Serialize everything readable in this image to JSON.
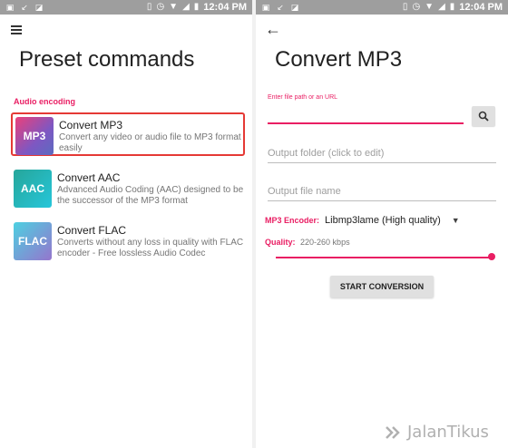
{
  "left_screen": {
    "status_bar": {
      "time": "12:04 PM",
      "icons": [
        "image-icon",
        "missed-call-icon",
        "photo-icon",
        "vibrate-icon",
        "alarm-icon",
        "wifi-icon",
        "signal-icon",
        "battery-icon"
      ]
    },
    "title": "Preset commands",
    "section_label": "Audio encoding",
    "presets": [
      {
        "badge": "MP3",
        "name": "Convert MP3",
        "description": "Convert any video or audio file to MP3 format easily"
      },
      {
        "badge": "AAC",
        "name": "Convert AAC",
        "description": "Advanced Audio Coding (AAC) designed to be the successor of the MP3 format"
      },
      {
        "badge": "FLAC",
        "name": "Convert FLAC",
        "description": "Converts without any loss in quality with FLAC encoder - Free lossless Audio Codec"
      }
    ]
  },
  "right_screen": {
    "status_bar": {
      "time": "12:04 PM"
    },
    "title": "Convert MP3",
    "file_field": {
      "hint": "Enter file path or an URL",
      "value": ""
    },
    "output_folder": {
      "placeholder": "Output folder (click to edit)"
    },
    "output_name": {
      "placeholder": "Output file name"
    },
    "encoder": {
      "label": "MP3 Encoder:",
      "value": "Libmp3lame (High quality)"
    },
    "quality": {
      "label": "Quality:",
      "value": "220-260 kbps",
      "slider_fraction": 1.0
    },
    "start_button": "START CONVERSION"
  },
  "watermark": "JalanTikus",
  "colors": {
    "accent": "#e91e63",
    "highlight_border": "#e53935",
    "status_bar": "#9e9e9e"
  }
}
